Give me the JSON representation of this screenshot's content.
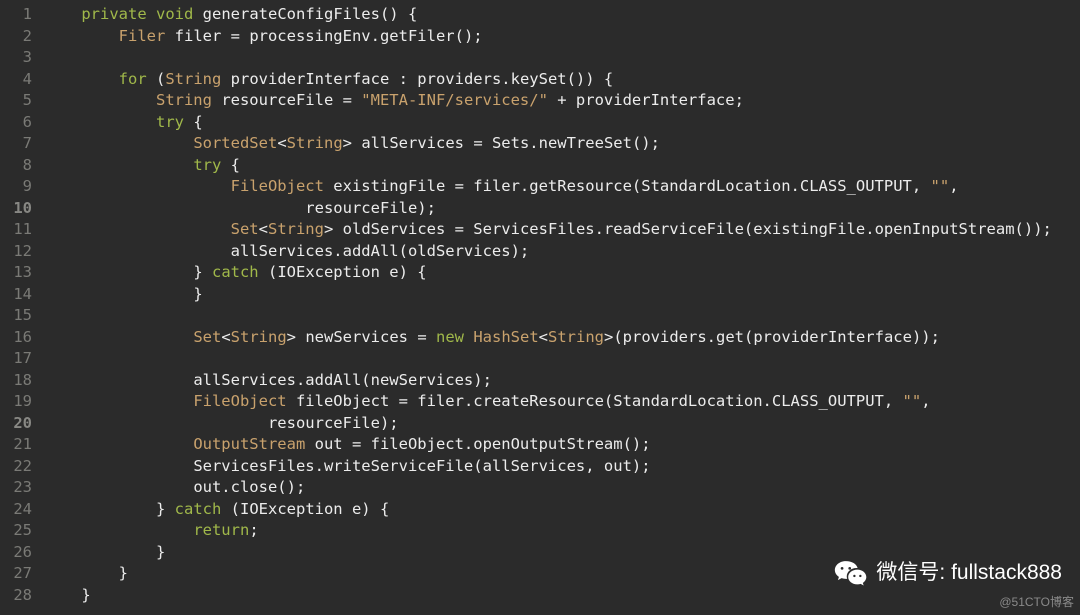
{
  "watermarks": {
    "wechat_label": "微信号: fullstack888",
    "cto_label": "@51CTO博客"
  },
  "line_numbers": [
    1,
    2,
    3,
    4,
    5,
    6,
    7,
    8,
    9,
    10,
    11,
    12,
    13,
    14,
    15,
    16,
    17,
    18,
    19,
    20,
    21,
    22,
    23,
    24,
    25,
    26,
    27,
    28
  ],
  "bold_line_numbers": [
    10,
    20
  ],
  "code": {
    "l1": {
      "indent": "    ",
      "k1": "private",
      "sp1": " ",
      "k2": "void",
      "sp2": " ",
      "fn": "generateConfigFiles() {"
    },
    "l2": {
      "indent": "        ",
      "t1": "Filer",
      "rest": " filer = processingEnv.getFiler();"
    },
    "l3": {
      "indent": "",
      "rest": ""
    },
    "l4": {
      "indent": "        ",
      "k1": "for",
      "sp": " (",
      "t1": "String",
      "rest": " providerInterface : providers.keySet()) {"
    },
    "l5": {
      "indent": "            ",
      "t1": "String",
      "mid": " resourceFile = ",
      "s1": "\"META-INF/services/\"",
      "rest": " + providerInterface;"
    },
    "l6": {
      "indent": "            ",
      "k1": "try",
      "rest": " {"
    },
    "l7": {
      "indent": "                ",
      "t1": "SortedSet",
      "lt": "<",
      "t2": "String",
      "gt": ">",
      "rest": " allServices = Sets.newTreeSet();"
    },
    "l8": {
      "indent": "                ",
      "k1": "try",
      "rest": " {"
    },
    "l9": {
      "indent": "                    ",
      "t1": "FileObject",
      "mid": " existingFile = filer.getResource(StandardLocation.CLASS_OUTPUT, ",
      "s1": "\"\"",
      "rest": ","
    },
    "l10": {
      "indent": "                            ",
      "rest": "resourceFile);"
    },
    "l11": {
      "indent": "                    ",
      "t1": "Set",
      "lt": "<",
      "t2": "String",
      "gt": ">",
      "rest": " oldServices = ServicesFiles.readServiceFile(existingFile.openInputStream());"
    },
    "l12": {
      "indent": "                    ",
      "rest": "allServices.addAll(oldServices);"
    },
    "l13": {
      "indent": "                ",
      "rest1": "} ",
      "k1": "catch",
      "rest2": " (IOException e) {"
    },
    "l14": {
      "indent": "                ",
      "rest": "}"
    },
    "l15": {
      "indent": "",
      "rest": ""
    },
    "l16": {
      "indent": "                ",
      "t1": "Set",
      "lt": "<",
      "t2": "String",
      "gt": ">",
      "mid": " newServices = ",
      "k1": "new",
      "sp": " ",
      "t3": "HashSet",
      "lt2": "<",
      "t4": "String",
      "gt2": ">",
      "rest": "(providers.get(providerInterface));"
    },
    "l17": {
      "indent": "",
      "rest": ""
    },
    "l18": {
      "indent": "                ",
      "rest": "allServices.addAll(newServices);"
    },
    "l19": {
      "indent": "                ",
      "t1": "FileObject",
      "mid": " fileObject = filer.createResource(StandardLocation.CLASS_OUTPUT, ",
      "s1": "\"\"",
      "rest": ","
    },
    "l20": {
      "indent": "                        ",
      "rest": "resourceFile);"
    },
    "l21": {
      "indent": "                ",
      "t1": "OutputStream",
      "rest": " out = fileObject.openOutputStream();"
    },
    "l22": {
      "indent": "                ",
      "rest": "ServicesFiles.writeServiceFile(allServices, out);"
    },
    "l23": {
      "indent": "                ",
      "rest": "out.close();"
    },
    "l24": {
      "indent": "            ",
      "rest1": "} ",
      "k1": "catch",
      "rest2": " (IOException e) {"
    },
    "l25": {
      "indent": "                ",
      "k1": "return",
      "rest": ";"
    },
    "l26": {
      "indent": "            ",
      "rest": "}"
    },
    "l27": {
      "indent": "        ",
      "rest": "}"
    },
    "l28": {
      "indent": "    ",
      "rest": "}"
    }
  }
}
